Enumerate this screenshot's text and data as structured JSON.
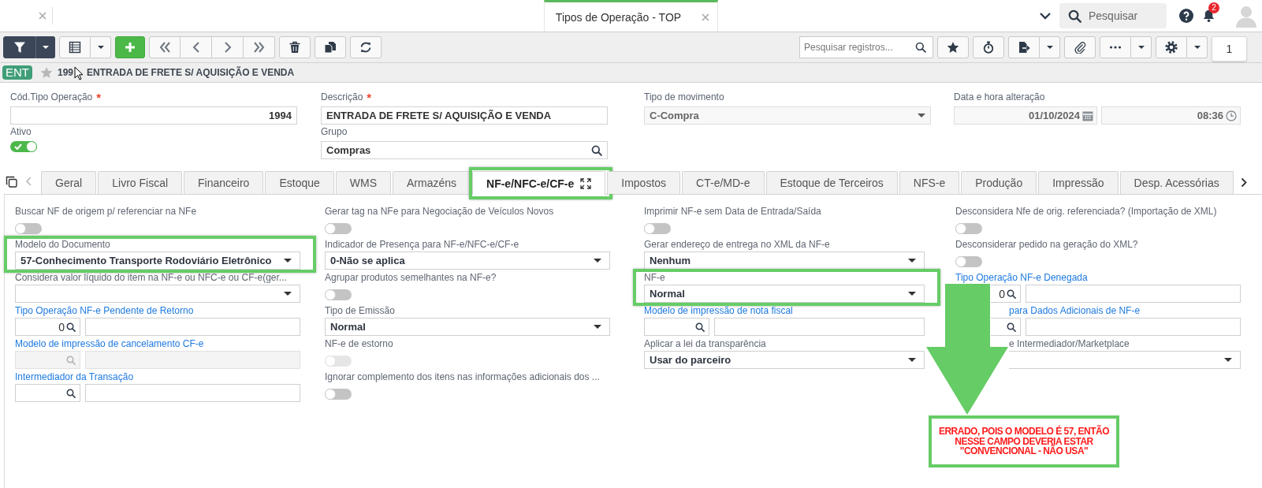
{
  "top_bar": {
    "tabs": [
      {
        "selected": false
      },
      {
        "label": "Tipos de Operação - TOP",
        "selected": true
      }
    ],
    "search": {
      "placeholder": "Pesquisar"
    },
    "notification_count": "2"
  },
  "toolbar": {
    "search": {
      "placeholder": "Pesquisar registros..."
    },
    "page": "1"
  },
  "record": {
    "badge": "ENT",
    "favorite": false,
    "code": "199",
    "title": "ENTRADA DE FRETE S/ AQUISIÇÃO E VENDA"
  },
  "header_fields": [
    {
      "kind": "number",
      "label": "Cód.Tipo Operação",
      "required_mark": "*",
      "value": "1994",
      "disabled": false
    },
    {
      "kind": "text",
      "label": "Descrição",
      "required_mark": "*",
      "value": "ENTRADA DE FRETE S/ AQUISIÇÃO E VENDA",
      "disabled": false
    },
    {
      "kind": "select",
      "label": "Tipo de movimento",
      "value": "C-Compra",
      "disabled": true
    },
    {
      "kind": "datetime",
      "label": "Data e hora alteração",
      "date": "01/10/2024",
      "time": "08:36",
      "disabled": true
    },
    {
      "kind": "toggle",
      "label": "Ativo",
      "on": true,
      "disabled": false
    },
    {
      "kind": "lookup",
      "label": "Grupo",
      "value": "Compras",
      "disabled": false
    }
  ],
  "tabs": [
    {
      "label": "Geral",
      "selected": false,
      "highlighted": false
    },
    {
      "label": "Livro Fiscal",
      "selected": false,
      "highlighted": false
    },
    {
      "label": "Financeiro",
      "selected": false,
      "highlighted": false
    },
    {
      "label": "Estoque",
      "selected": false,
      "highlighted": false
    },
    {
      "label": "WMS",
      "selected": false,
      "highlighted": false
    },
    {
      "label": "Armazéns",
      "selected": false,
      "highlighted": false
    },
    {
      "label": "NF-e/NFC-e/CF-e",
      "selected": true,
      "highlighted": true
    },
    {
      "label": "Impostos",
      "selected": false,
      "highlighted": false
    },
    {
      "label": "CT-e/MD-e",
      "selected": false,
      "highlighted": false
    },
    {
      "label": "Estoque de Terceiros",
      "selected": false,
      "highlighted": false
    },
    {
      "label": "NFS-e",
      "selected": false,
      "highlighted": false
    },
    {
      "label": "Produção",
      "selected": false,
      "highlighted": false
    },
    {
      "label": "Impressão",
      "selected": false,
      "highlighted": false
    },
    {
      "label": "Desp. Acessórias",
      "selected": false,
      "highlighted": false
    }
  ],
  "columns": [
    {
      "fields": [
        {
          "kind": "toggle",
          "label": "Buscar NF de origem p/ referenciar na NFe",
          "on": false,
          "disabled": false,
          "highlighted": false
        },
        {
          "kind": "select",
          "label": "Modelo do Documento",
          "value": "57-Conhecimento Transporte Rodoviário Eletrônico",
          "disabled": false,
          "highlighted": true
        },
        {
          "kind": "select",
          "label": "Considera valor líquido do item na NF-e ou NFC-e ou CF-e(ger...",
          "disabled": false,
          "highlighted": false
        },
        {
          "kind": "lookup",
          "label": "Tipo Operação NF-e Pendente de Retorno",
          "code": "0",
          "disabled": false,
          "highlighted": false
        },
        {
          "kind": "lookup",
          "label": "Modelo de impressão de cancelamento CF-e",
          "disabled": true,
          "highlighted": false
        },
        {
          "kind": "lookup",
          "label": "Intermediador da Transação",
          "disabled": false,
          "highlighted": false
        }
      ]
    },
    {
      "fields": [
        {
          "kind": "toggle",
          "label": "Gerar tag na NFe para Negociação de Veículos Novos",
          "on": false,
          "disabled": false,
          "highlighted": false
        },
        {
          "kind": "select",
          "label": "Indicador de Presença para NF-e/NFC-e/CF-e",
          "value": "0-Não se aplica",
          "disabled": false,
          "highlighted": false
        },
        {
          "kind": "toggle",
          "label": "Agrupar produtos semelhantes na NF-e?",
          "on": false,
          "disabled": false,
          "highlighted": false
        },
        {
          "kind": "select",
          "label": "Tipo de Emissão",
          "value": "Normal",
          "disabled": false,
          "highlighted": false
        },
        {
          "kind": "toggle",
          "label": "NF-e de estorno",
          "on": false,
          "disabled": true,
          "highlighted": false
        },
        {
          "kind": "toggle",
          "label": "Ignorar complemento dos itens nas informações adicionais dos ...",
          "on": false,
          "disabled": false,
          "highlighted": false
        }
      ]
    },
    {
      "fields": [
        {
          "kind": "toggle",
          "label": "Imprimir NF-e sem Data de Entrada/Saída",
          "on": false,
          "disabled": false,
          "highlighted": false
        },
        {
          "kind": "select",
          "label": "Gerar endereço de entrega no XML da NF-e",
          "value": "Nenhum",
          "disabled": false,
          "highlighted": false
        },
        {
          "kind": "select",
          "label": "NF-e",
          "value": "Normal",
          "disabled": false,
          "highlighted": true
        },
        {
          "kind": "lookup",
          "label": "Modelo de impressão de nota fiscal",
          "disabled": false,
          "highlighted": false
        },
        {
          "kind": "select",
          "label": "Aplicar a lei da transparência",
          "value": "Usar do parceiro",
          "disabled": false,
          "highlighted": false
        }
      ]
    },
    {
      "fields": [
        {
          "kind": "toggle",
          "label": "Desconsidera Nfe de orig. referenciada? (Importação de XML)",
          "on": false,
          "disabled": false,
          "highlighted": false
        },
        {
          "kind": "toggle",
          "label": "Desconsiderar pedido na geração do XML?",
          "on": false,
          "disabled": false,
          "highlighted": false
        },
        {
          "kind": "lookup",
          "label": "Tipo Operação NF-e Denegada",
          "code": "0",
          "disabled": false,
          "highlighted": false,
          "label_partly_covered": false,
          "field_partly_covered": true
        },
        {
          "kind": "lookup",
          "label": "para Dados Adicionais de NF-e",
          "disabled": false,
          "highlighted": false,
          "label_partly_covered": true,
          "field_partly_covered": true
        },
        {
          "kind": "select",
          "label": "e Intermediador/Marketplace",
          "disabled": false,
          "highlighted": false,
          "label_partly_covered": true,
          "field_partly_covered": true
        }
      ]
    }
  ],
  "annotation": {
    "text": "ERRADO, POIS O MODELO É 57, ENTÃO\nNESSE CAMPO DEVERIA ESTAR\n\"CONVENCIONAL - NÃO USA\""
  }
}
